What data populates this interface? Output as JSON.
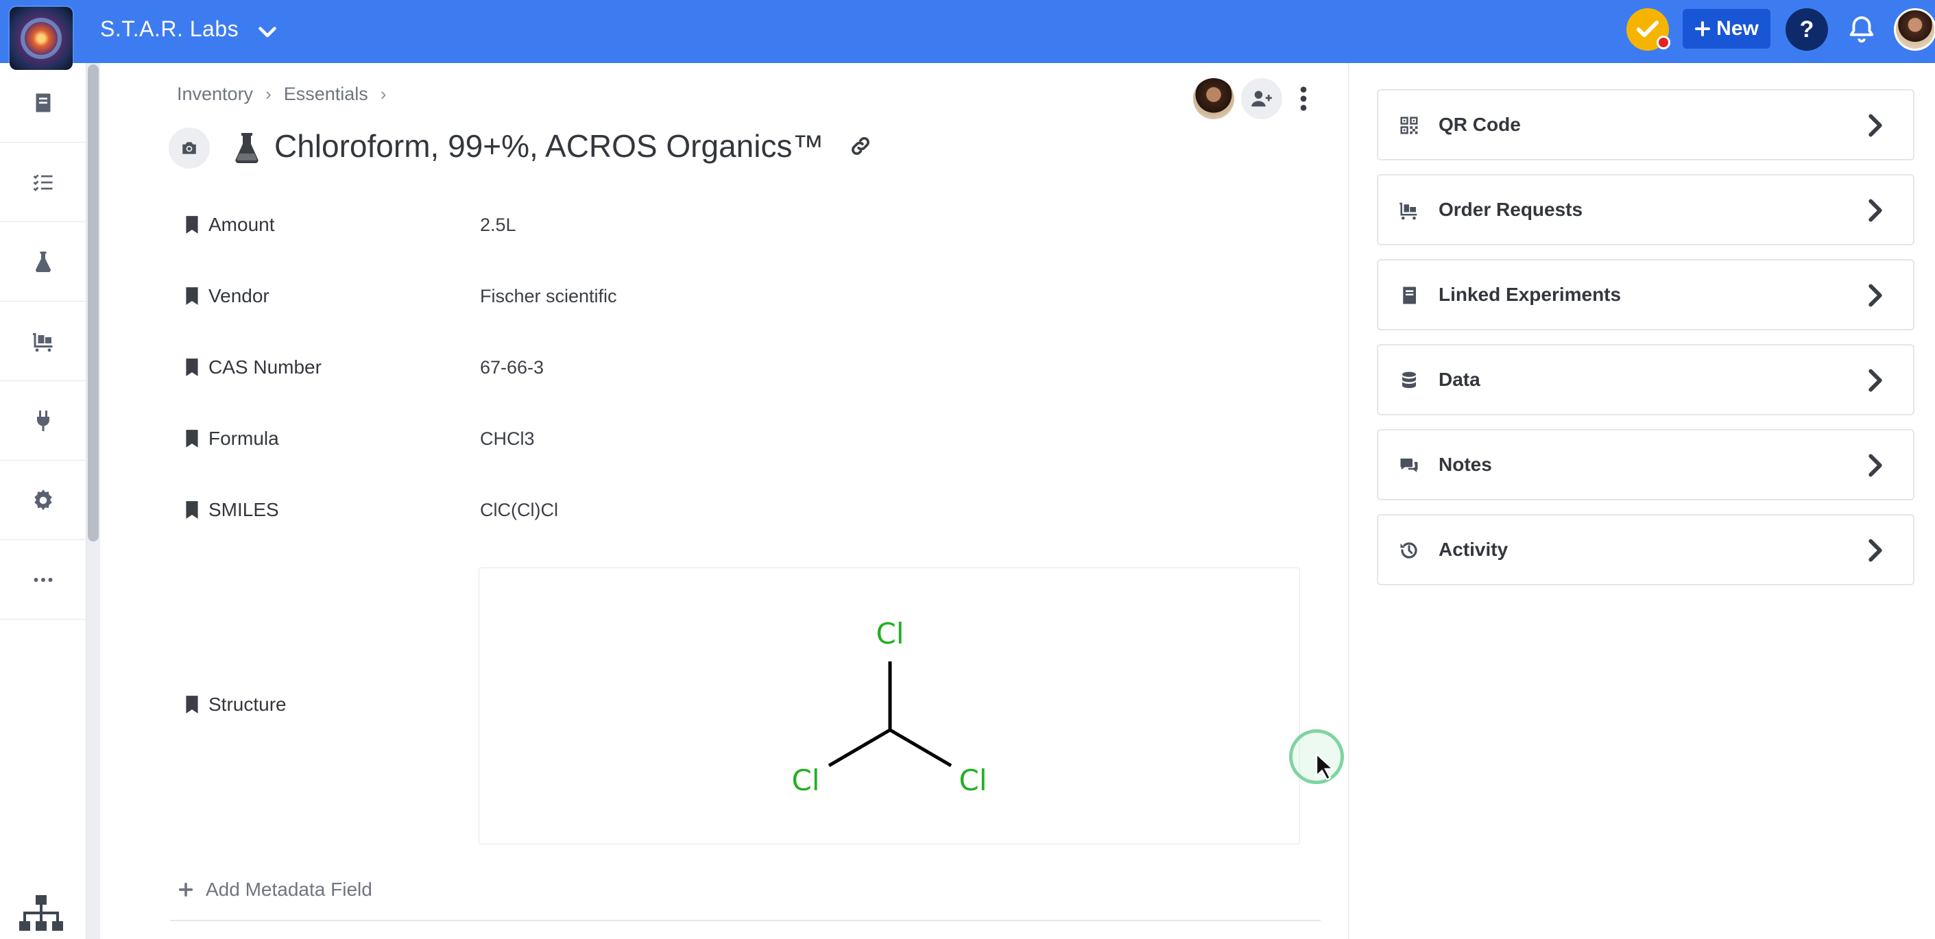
{
  "header": {
    "org_name": "S.T.A.R. Labs",
    "new_label": "New",
    "help_label": "?"
  },
  "sidebar": {
    "items": [
      {
        "icon": "notebook-icon"
      },
      {
        "icon": "tasks-icon"
      },
      {
        "icon": "flask-icon"
      },
      {
        "icon": "cart-icon"
      },
      {
        "icon": "plug-icon"
      },
      {
        "icon": "gear-icon"
      },
      {
        "icon": "more-icon"
      }
    ],
    "bottom_icon": "sitemap-icon"
  },
  "breadcrumb": [
    "Inventory",
    "Essentials"
  ],
  "item": {
    "title": "Chloroform, 99+%, ACROS Organics™",
    "metadata": [
      {
        "label": "Amount",
        "value": "2.5L"
      },
      {
        "label": "Vendor",
        "value": "Fischer scientific"
      },
      {
        "label": "CAS Number",
        "value": "67-66-3"
      },
      {
        "label": "Formula",
        "value": "CHCl3"
      },
      {
        "label": "SMILES",
        "value": "ClC(Cl)Cl"
      }
    ],
    "structure_label": "Structure",
    "structure_atoms": {
      "top": "Cl",
      "left": "Cl",
      "right": "Cl"
    },
    "structure_color": "#22b022",
    "add_metadata_label": "Add Metadata Field"
  },
  "right_panel": {
    "cards": [
      {
        "label": "QR Code",
        "icon": "qrcode-icon"
      },
      {
        "label": "Order Requests",
        "icon": "cart-icon"
      },
      {
        "label": "Linked Experiments",
        "icon": "book-icon"
      },
      {
        "label": "Data",
        "icon": "database-icon"
      },
      {
        "label": "Notes",
        "icon": "comments-icon"
      },
      {
        "label": "Activity",
        "icon": "history-icon"
      }
    ]
  },
  "colors": {
    "topbar": "#3d7cf0",
    "new_button": "#1956d6",
    "help_button": "#0f2a6b",
    "badge": "#f6b400"
  }
}
